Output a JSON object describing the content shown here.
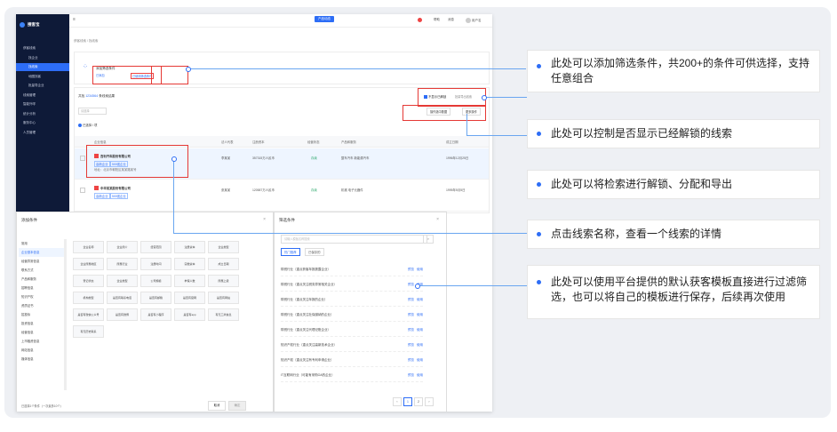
{
  "sidebar": {
    "logo": "搜客宝",
    "items": [
      {
        "label": "获客线索",
        "sub": false
      },
      {
        "label": "找企业",
        "sub": true
      },
      {
        "label": "找线索",
        "sub": true,
        "active": true
      },
      {
        "label": "地图找客",
        "sub": true
      },
      {
        "label": "批量导企业",
        "sub": true
      },
      {
        "label": "线索管理",
        "sub": false
      },
      {
        "label": "智能外呼",
        "sub": false
      },
      {
        "label": "统计分析",
        "sub": false
      },
      {
        "label": "服务中心",
        "sub": false
      },
      {
        "label": "人员管理",
        "sub": false
      }
    ]
  },
  "topbar": {
    "center_btn": "产品动态",
    "help": "帮助",
    "msg": "消息",
    "user": "用户名"
  },
  "breadcrumb": "获客线索 / 找线索",
  "filter_panel": {
    "add_label": "添加筛选条件",
    "sub1": "已添加",
    "sub2": "已使用筛选条件"
  },
  "results": {
    "count_prefix": "共找",
    "count": "1234564",
    "count_suffix": "条线索结果",
    "hide_unlocked": "不显示已解锁",
    "export_hint": "批量导出线索",
    "select_placeholder": "请选择",
    "selected_label": "已选择 / 项",
    "btn_assign": "操作选中数据",
    "btn_more": "更多操作",
    "columns": [
      "企业信息",
      "法人代表",
      "注册资本",
      "经营状态",
      "产品和服务",
      "成立日期"
    ],
    "rows": [
      {
        "name": "吉利汽车股份有限公司",
        "tag1": "高新企业",
        "tag2": "500强企业",
        "addr": "地址：北京市朝阳区某某路某号",
        "legal": "李某某",
        "capital": "357315万人民币",
        "status": "存续",
        "product": "整车汽车 新能源汽车",
        "date": "1996年12月25日"
      },
      {
        "name": "中华某某股份有限公司",
        "tag1": "高新企业",
        "tag2": "500强企业",
        "addr": "",
        "legal": "张某某",
        "capital": "120587万人民币",
        "status": "存续",
        "product": "机械 电子元器件",
        "date": "1995年5月5日"
      }
    ]
  },
  "add_modal": {
    "title": "添加条件",
    "categories": [
      "常用",
      "企业基本信息",
      "经营异常信息",
      "联系方式",
      "产品和服务",
      "招聘信息",
      "知识产权",
      "资质证书",
      "招投标",
      "投资信息",
      "经营信息",
      "上市融资信息",
      "网站信息",
      "媒体信息"
    ],
    "grid": [
      [
        "企业名称",
        "企业简介",
        "经营范围",
        "注册资本",
        "企业类型"
      ],
      [
        "企业所属地区",
        "所属行业",
        "注册时间",
        "实缴资本",
        "成立日期"
      ],
      [
        "登记状态",
        "企业类型",
        "公司规模",
        "参保人数",
        "所属上级"
      ],
      [
        "机构类型",
        "是否有联系电话",
        "是否有邮箱",
        "是否有官网",
        "是否有网站"
      ],
      [
        "是否有微信公众号",
        "是否有微博",
        "是否有小程序",
        "是否有app",
        "有无工商信息"
      ],
      [
        "有无历史联系"
      ]
    ],
    "footer_text": "已选择1个条件（一次最多10个）",
    "cancel": "取消",
    "confirm": "确定"
  },
  "filter_modal": {
    "title": "筛选条件",
    "search_placeholder": "请输入模板名称搜索",
    "tab1": "热门推荐",
    "tab2": "已保存的",
    "templates": [
      "财税行业（重点获客年报披露企业）",
      "财税行业（重点关注税务异常相关企业）",
      "财税行业（重点关注年报的企业）",
      "财税行业（重点关注社保缴纳的企业）",
      "财税行业（重点关注代理记账企业）",
      "知识产权行业（重点关注高新技术企业）",
      "知识产权（重点关注有专利申请企业）",
      "IT互联网行业（可能有采购OA的企业）"
    ],
    "op_preview": "预览",
    "op_use": "使用",
    "pages": [
      "1",
      "2"
    ]
  },
  "callouts": [
    "此处可以添加筛选条件，共200+的条件可供选择，支持任意组合",
    "此处可以控制是否显示已经解锁的线索",
    "此处可以将检索进行解锁、分配和导出",
    "点击线索名称，查看一个线索的详情",
    "此处可以使用平台提供的默认获客模板直接进行过滤筛选，也可以将自己的模板进行保存，后续再次使用"
  ],
  "colors": {
    "accent": "#2d6df6",
    "highlight": "#e53935",
    "sidebar": "#0e1a38"
  }
}
